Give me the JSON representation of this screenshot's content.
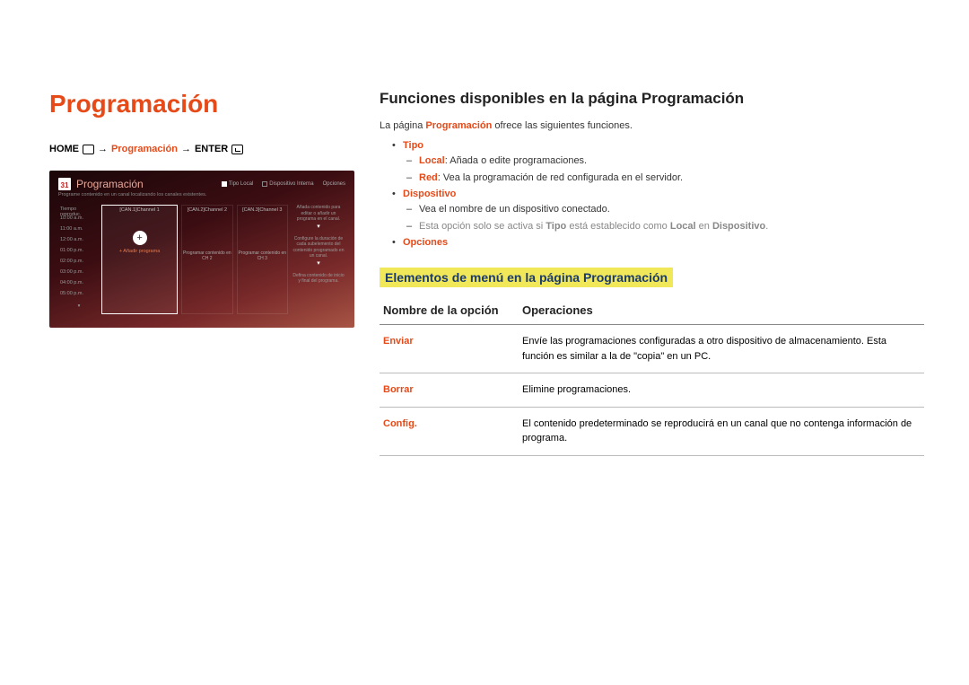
{
  "left": {
    "title": "Programación",
    "breadcrumb": {
      "home": "HOME",
      "arrow1": "→",
      "mid": "Programación",
      "arrow2": "→",
      "enter": "ENTER"
    }
  },
  "mock": {
    "calendar_day": "31",
    "title": "Programación",
    "tabs": {
      "tipo": "Tipo Local",
      "disp": "Dispositivo Interna",
      "opc": "Opciones"
    },
    "subtitle": "Programe contenido en un canal localizando los canales existentes.",
    "time_header": "Tiempo reproduc.",
    "times": [
      "10:00 a.m.",
      "11:00 a.m.",
      "12:00 a.m.",
      "01:00 p.m.",
      "02:00 p.m.",
      "03:00 p.m.",
      "04:00 p.m.",
      "05:00 p.m."
    ],
    "channels": [
      "[CAN.1]Channel 1",
      "[CAN.2]Channel 2",
      "[CAN.3]Channel 3"
    ],
    "add_label": "+ Añadir programa",
    "prog2": "Programar contenido en CH 2",
    "prog3": "Programar contenido en CH 3",
    "side1": "Añada contenido para editar o añadir un programa en el canal.",
    "side2": "Configure la duración de cada subelemento del contenido programado en un canal.",
    "side3": "Defina contenido de inicio y final del programa."
  },
  "right": {
    "section_title": "Funciones disponibles en la página Programación",
    "intro_pre": "La página ",
    "intro_kw": "Programación",
    "intro_post": " ofrece las siguientes funciones.",
    "features": {
      "tipo": {
        "label": "Tipo",
        "local_kw": "Local",
        "local_txt": ": Añada o edite programaciones.",
        "red_kw": "Red",
        "red_txt": ": Vea la programación de red configurada en el servidor."
      },
      "dispositivo": {
        "label": "Dispositivo",
        "line1": "Vea el nombre de un dispositivo conectado.",
        "note_pre": "Esta opción solo se activa si ",
        "note_kw1": "Tipo",
        "note_mid": " está establecido como ",
        "note_kw2": "Local",
        "note_mid2": " en ",
        "note_kw3": "Dispositivo",
        "note_end": "."
      },
      "opciones": {
        "label": "Opciones"
      }
    },
    "subsection": "Elementos de menú en la página Programación",
    "table": {
      "head_name": "Nombre de la opción",
      "head_ops": "Operaciones",
      "rows": [
        {
          "name": "Enviar",
          "ops": "Envíe las programaciones configuradas a otro dispositivo de almacenamiento. Esta función es similar a la de \"copia\" en un PC."
        },
        {
          "name": "Borrar",
          "ops": "Elimine programaciones."
        },
        {
          "name": "Config.",
          "ops": "El contenido predeterminado se reproducirá en un canal que no contenga información de programa."
        }
      ]
    }
  }
}
